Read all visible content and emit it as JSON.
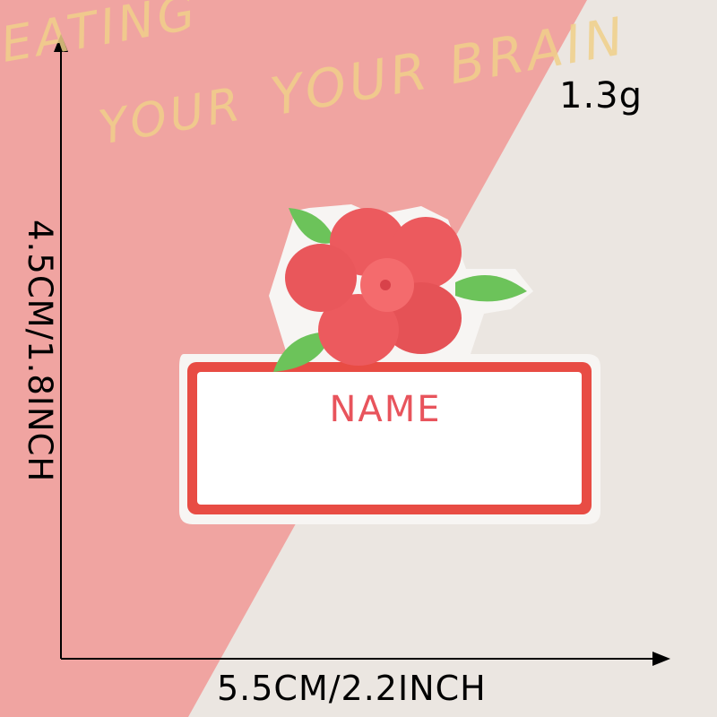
{
  "background": {
    "pink_color": "#f0a4a1",
    "cream_color": "#ebe6e1",
    "text_line_1": "EATING",
    "text_line_2": "YOUR BRAIN",
    "text_line_3": "YOUR"
  },
  "product": {
    "patch_label": "NAME",
    "weight": "1.3g",
    "width": "5.5CM/2.2INCH",
    "height": "4.5CM/1.8INCH",
    "border_color": "#e84c44",
    "petal_color": "#ec5a5e",
    "leaf_color": "#6cc35a"
  }
}
